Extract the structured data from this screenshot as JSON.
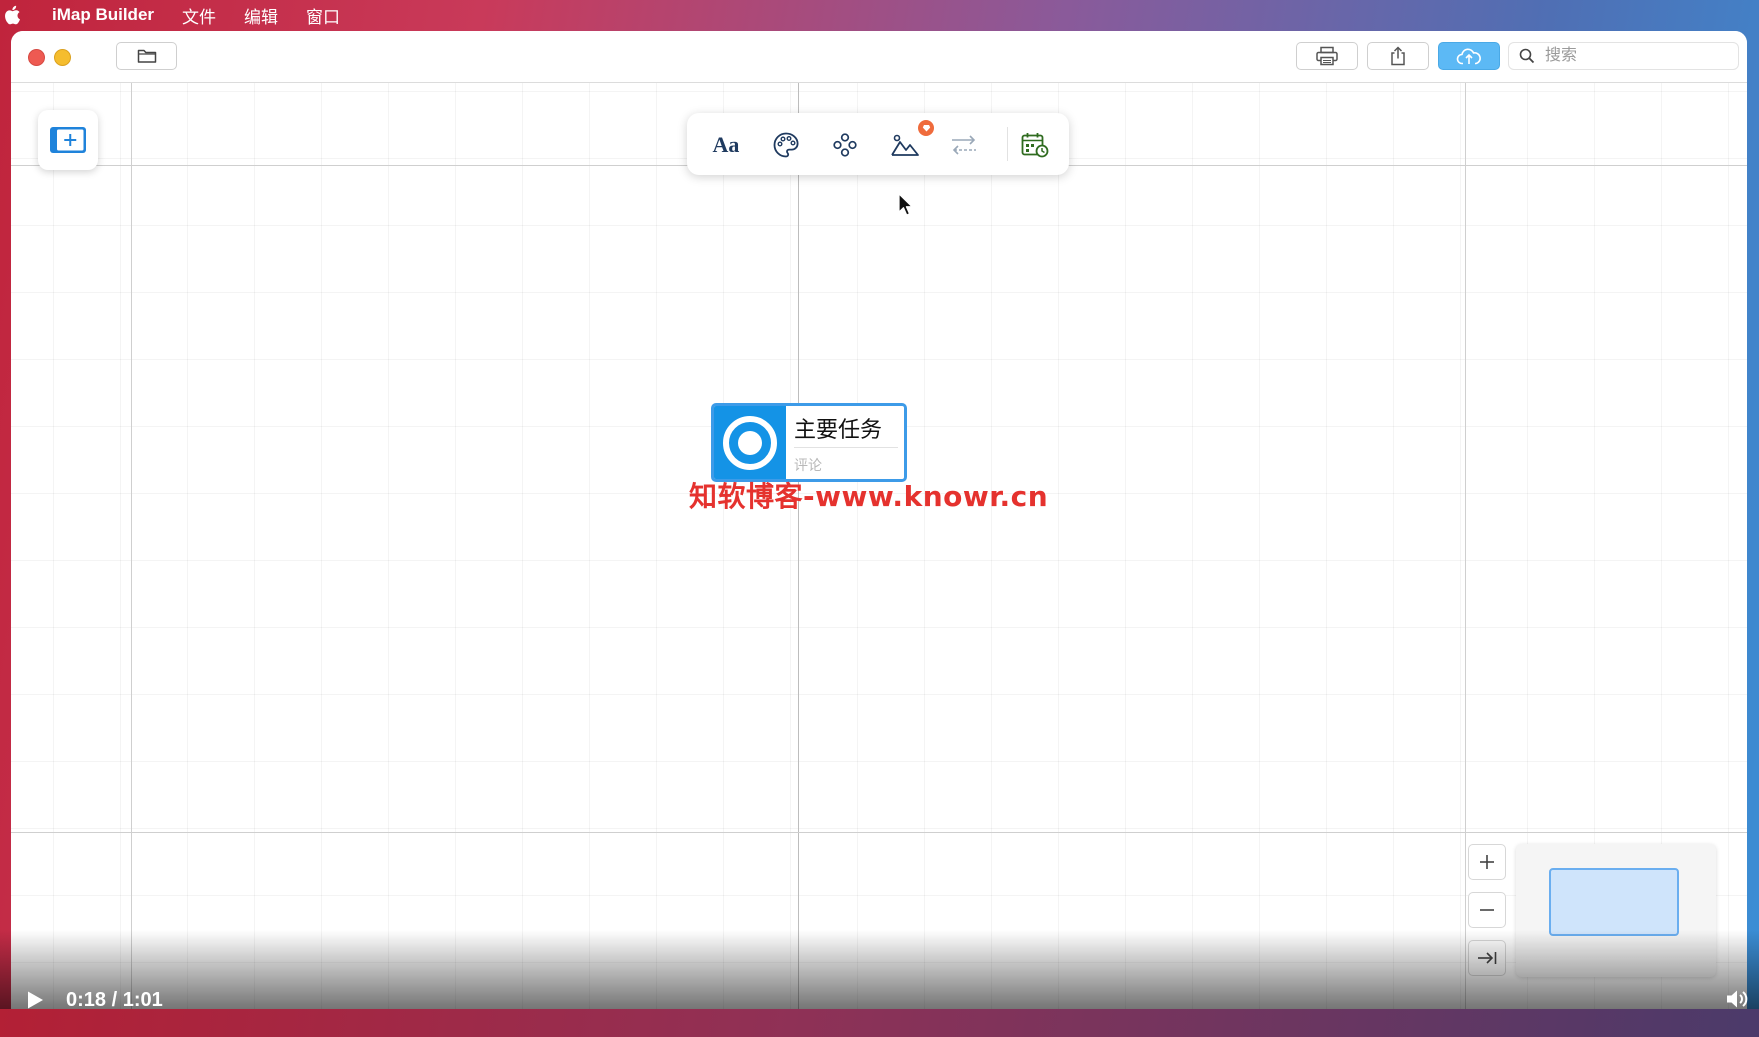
{
  "menubar": {
    "app_name": "iMap Builder",
    "items": [
      "文件",
      "编辑",
      "窗口"
    ]
  },
  "toolbar": {
    "search_placeholder": "搜索"
  },
  "format_bar": {
    "font_label": "Aa"
  },
  "topic": {
    "title": "主要任务",
    "comment": "评论"
  },
  "watermark": "知软博客-www.knowr.cn",
  "video": {
    "time": "0:18 / 1:01"
  },
  "colors": {
    "accent": "#1493e6",
    "cloud_button": "#5cb9f5",
    "watermark": "#e5322e",
    "badge": "#ef6b3c"
  }
}
